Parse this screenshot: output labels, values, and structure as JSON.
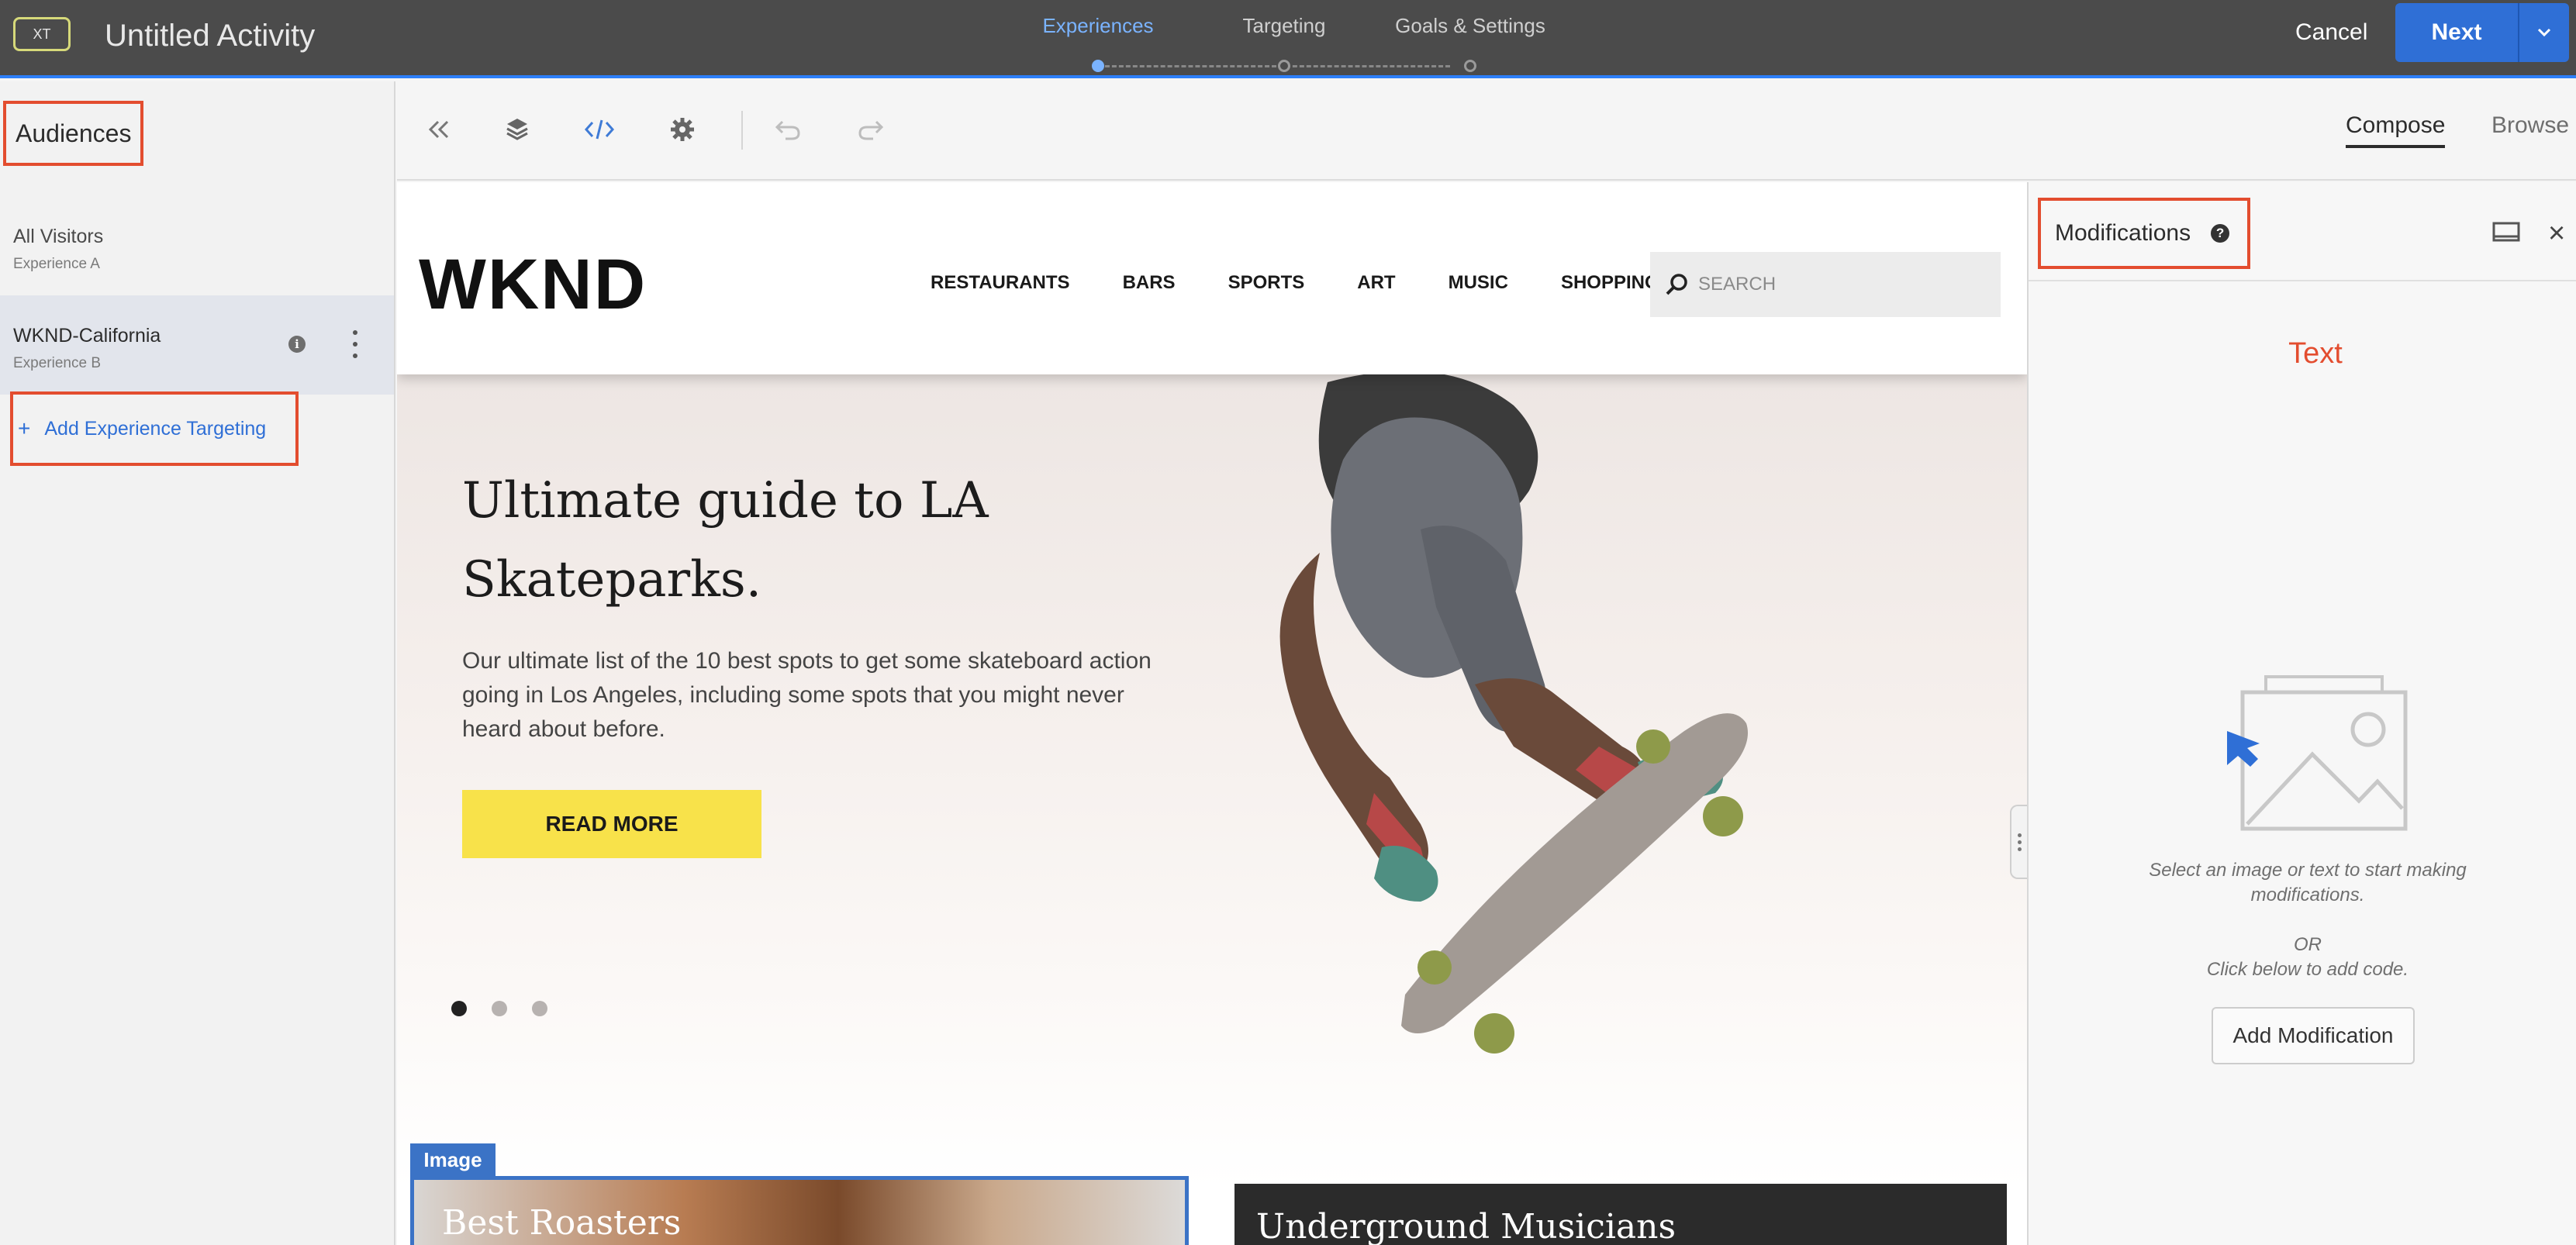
{
  "topbar": {
    "badge": "XT",
    "activity_title": "Untitled Activity",
    "steps": [
      {
        "label": "Experiences",
        "active": true
      },
      {
        "label": "Targeting",
        "active": false
      },
      {
        "label": "Goals & Settings",
        "active": false
      }
    ],
    "cancel_label": "Cancel",
    "next_label": "Next"
  },
  "left_panel": {
    "title": "Audiences",
    "audiences": [
      {
        "name": "All Visitors",
        "experience": "Experience A",
        "selected": false
      },
      {
        "name": "WKND-California",
        "experience": "Experience B",
        "selected": true
      }
    ],
    "add_targeting_label": "Add Experience Targeting"
  },
  "toolbar": {
    "icons": [
      "collapse-icon",
      "layers-icon",
      "code-icon",
      "settings-icon",
      "undo-icon",
      "redo-icon"
    ],
    "tabs": {
      "compose": "Compose",
      "browse": "Browse"
    }
  },
  "website": {
    "logo": "WKND",
    "nav": [
      "RESTAURANTS",
      "BARS",
      "SPORTS",
      "ART",
      "MUSIC",
      "SHOPPING"
    ],
    "search_placeholder": "SEARCH",
    "hero": {
      "title": "Ultimate guide to LA Skateparks.",
      "text": "Our ultimate list of the 10 best spots to get some skateboard action going in Los Angeles, including some spots that you might never heard about before.",
      "cta": "READ MORE",
      "slides": 3,
      "active_slide": 1
    },
    "image_tag": "Image",
    "cards": [
      {
        "title": "Best Roasters"
      },
      {
        "title": "Underground Musicians"
      }
    ]
  },
  "right_panel": {
    "title": "Modifications",
    "text_label": "Text",
    "hint_line1": "Select an image or text to start making modifications.",
    "hint_or": "OR",
    "hint_line2": "Click below to add code.",
    "add_button": "Add Modification"
  },
  "colors": {
    "topbar_bg": "#4b4b4b",
    "accent_blue": "#2f6fd6",
    "highlight_red": "#e34d2f",
    "cta_yellow": "#f8e24a"
  }
}
